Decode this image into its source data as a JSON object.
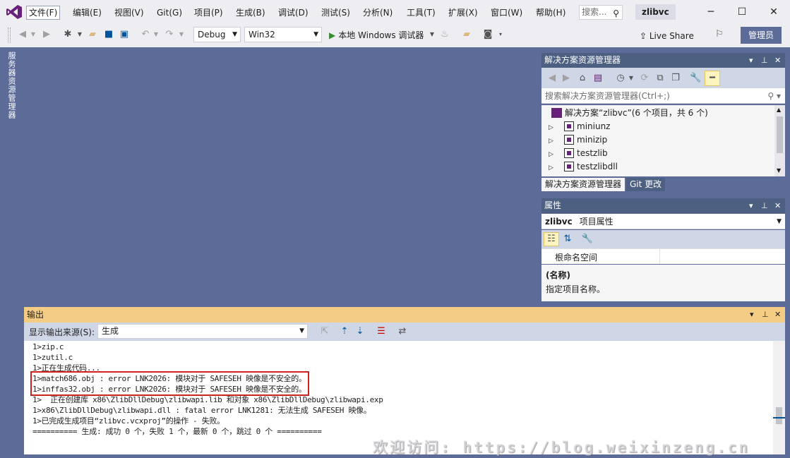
{
  "menu": {
    "items": [
      "文件(F)",
      "编辑(E)",
      "视图(V)",
      "Git(G)",
      "项目(P)",
      "生成(B)",
      "调试(D)",
      "测试(S)",
      "分析(N)",
      "工具(T)",
      "扩展(X)",
      "窗口(W)",
      "帮助(H)"
    ],
    "search_placeholder": "搜索...",
    "solution_title": "zlibvc"
  },
  "toolbar": {
    "config": "Debug",
    "platform": "Win32",
    "run_label": "本地 Windows 调试器",
    "live_share": "Live Share",
    "admin_label": "管理员"
  },
  "left_tab": {
    "label": "服务器资源管理器"
  },
  "solution_explorer": {
    "title": "解决方案资源管理器",
    "search_placeholder": "搜索解决方案资源管理器(Ctrl+;)",
    "root": "解决方案“zlibvc”(6 个项目，共 6 个)",
    "projects": [
      "miniunz",
      "minizip",
      "testzlib",
      "testzlibdll"
    ],
    "tabs": [
      "解决方案资源管理器",
      "Git 更改"
    ]
  },
  "properties": {
    "title": "属性",
    "object_name": "zlibvc",
    "object_type": "项目属性",
    "row_name": "根命名空间",
    "desc_title": "(名称)",
    "desc_text": "指定项目名称。"
  },
  "output": {
    "title": "输出",
    "source_label": "显示输出来源(S):",
    "source_value": "生成",
    "lines": [
      "1>zip.c",
      "1>zutil.c",
      "1>正在生成代码...",
      "1>match686.obj : error LNK2026: 模块对于 SAFESEH 映像是不安全的。",
      "1>inffas32.obj : error LNK2026: 模块对于 SAFESEH 映像是不安全的。",
      "1>  正在创建库 x86\\ZlibDllDebug\\zlibwapi.lib 和对象 x86\\ZlibDllDebug\\zlibwapi.exp",
      "1>x86\\ZlibDllDebug\\zlibwapi.dll : fatal error LNK1281: 无法生成 SAFESEH 映像。",
      "1>已完成生成项目“zlibvc.vcxproj”的操作 - 失败。",
      "========== 生成: 成功 0 个，失败 1 个，最新 0 个，跳过 0 个 =========="
    ]
  },
  "watermark": "欢迎访问: https://blog.weixinzeng.cn",
  "colors": {
    "accent": "#68217a",
    "background": "#5d6b99",
    "active_header": "#f5cc84",
    "error_box": "#d02020"
  }
}
